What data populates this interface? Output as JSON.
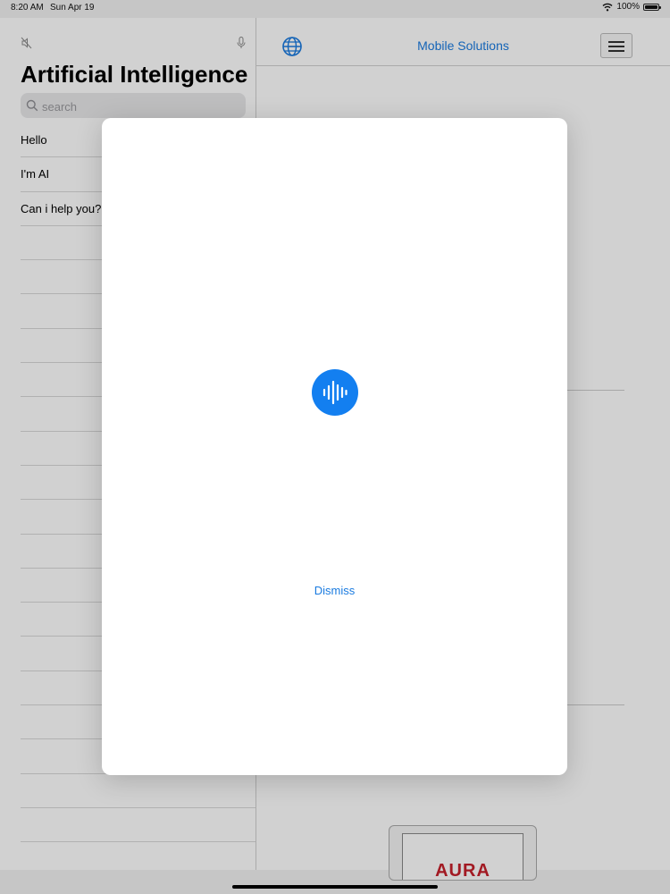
{
  "status_bar": {
    "time": "8:20 AM",
    "date": "Sun Apr 19",
    "battery_text": "100%",
    "battery_level": 1.0
  },
  "sidebar": {
    "title": "Artificial Intelligence",
    "search": {
      "placeholder": "search",
      "value": ""
    },
    "items": [
      {
        "label": "Hello"
      },
      {
        "label": "I'm AI"
      },
      {
        "label": "Can i help you?"
      }
    ],
    "icons": [
      "speaker-muted-icon",
      "microphone-icon",
      "search-icon"
    ]
  },
  "detail": {
    "nav_title": "Mobile Solutions",
    "icons": [
      "globe-icon",
      "hamburger-menu-icon"
    ],
    "product_brand": "AURA"
  },
  "modal": {
    "voice_icon": "waveform-icon",
    "dismiss_label": "Dismiss"
  },
  "colors": {
    "accent": "#1a7be0",
    "voice_button": "#137ff0",
    "brand_red": "#c6202b"
  }
}
